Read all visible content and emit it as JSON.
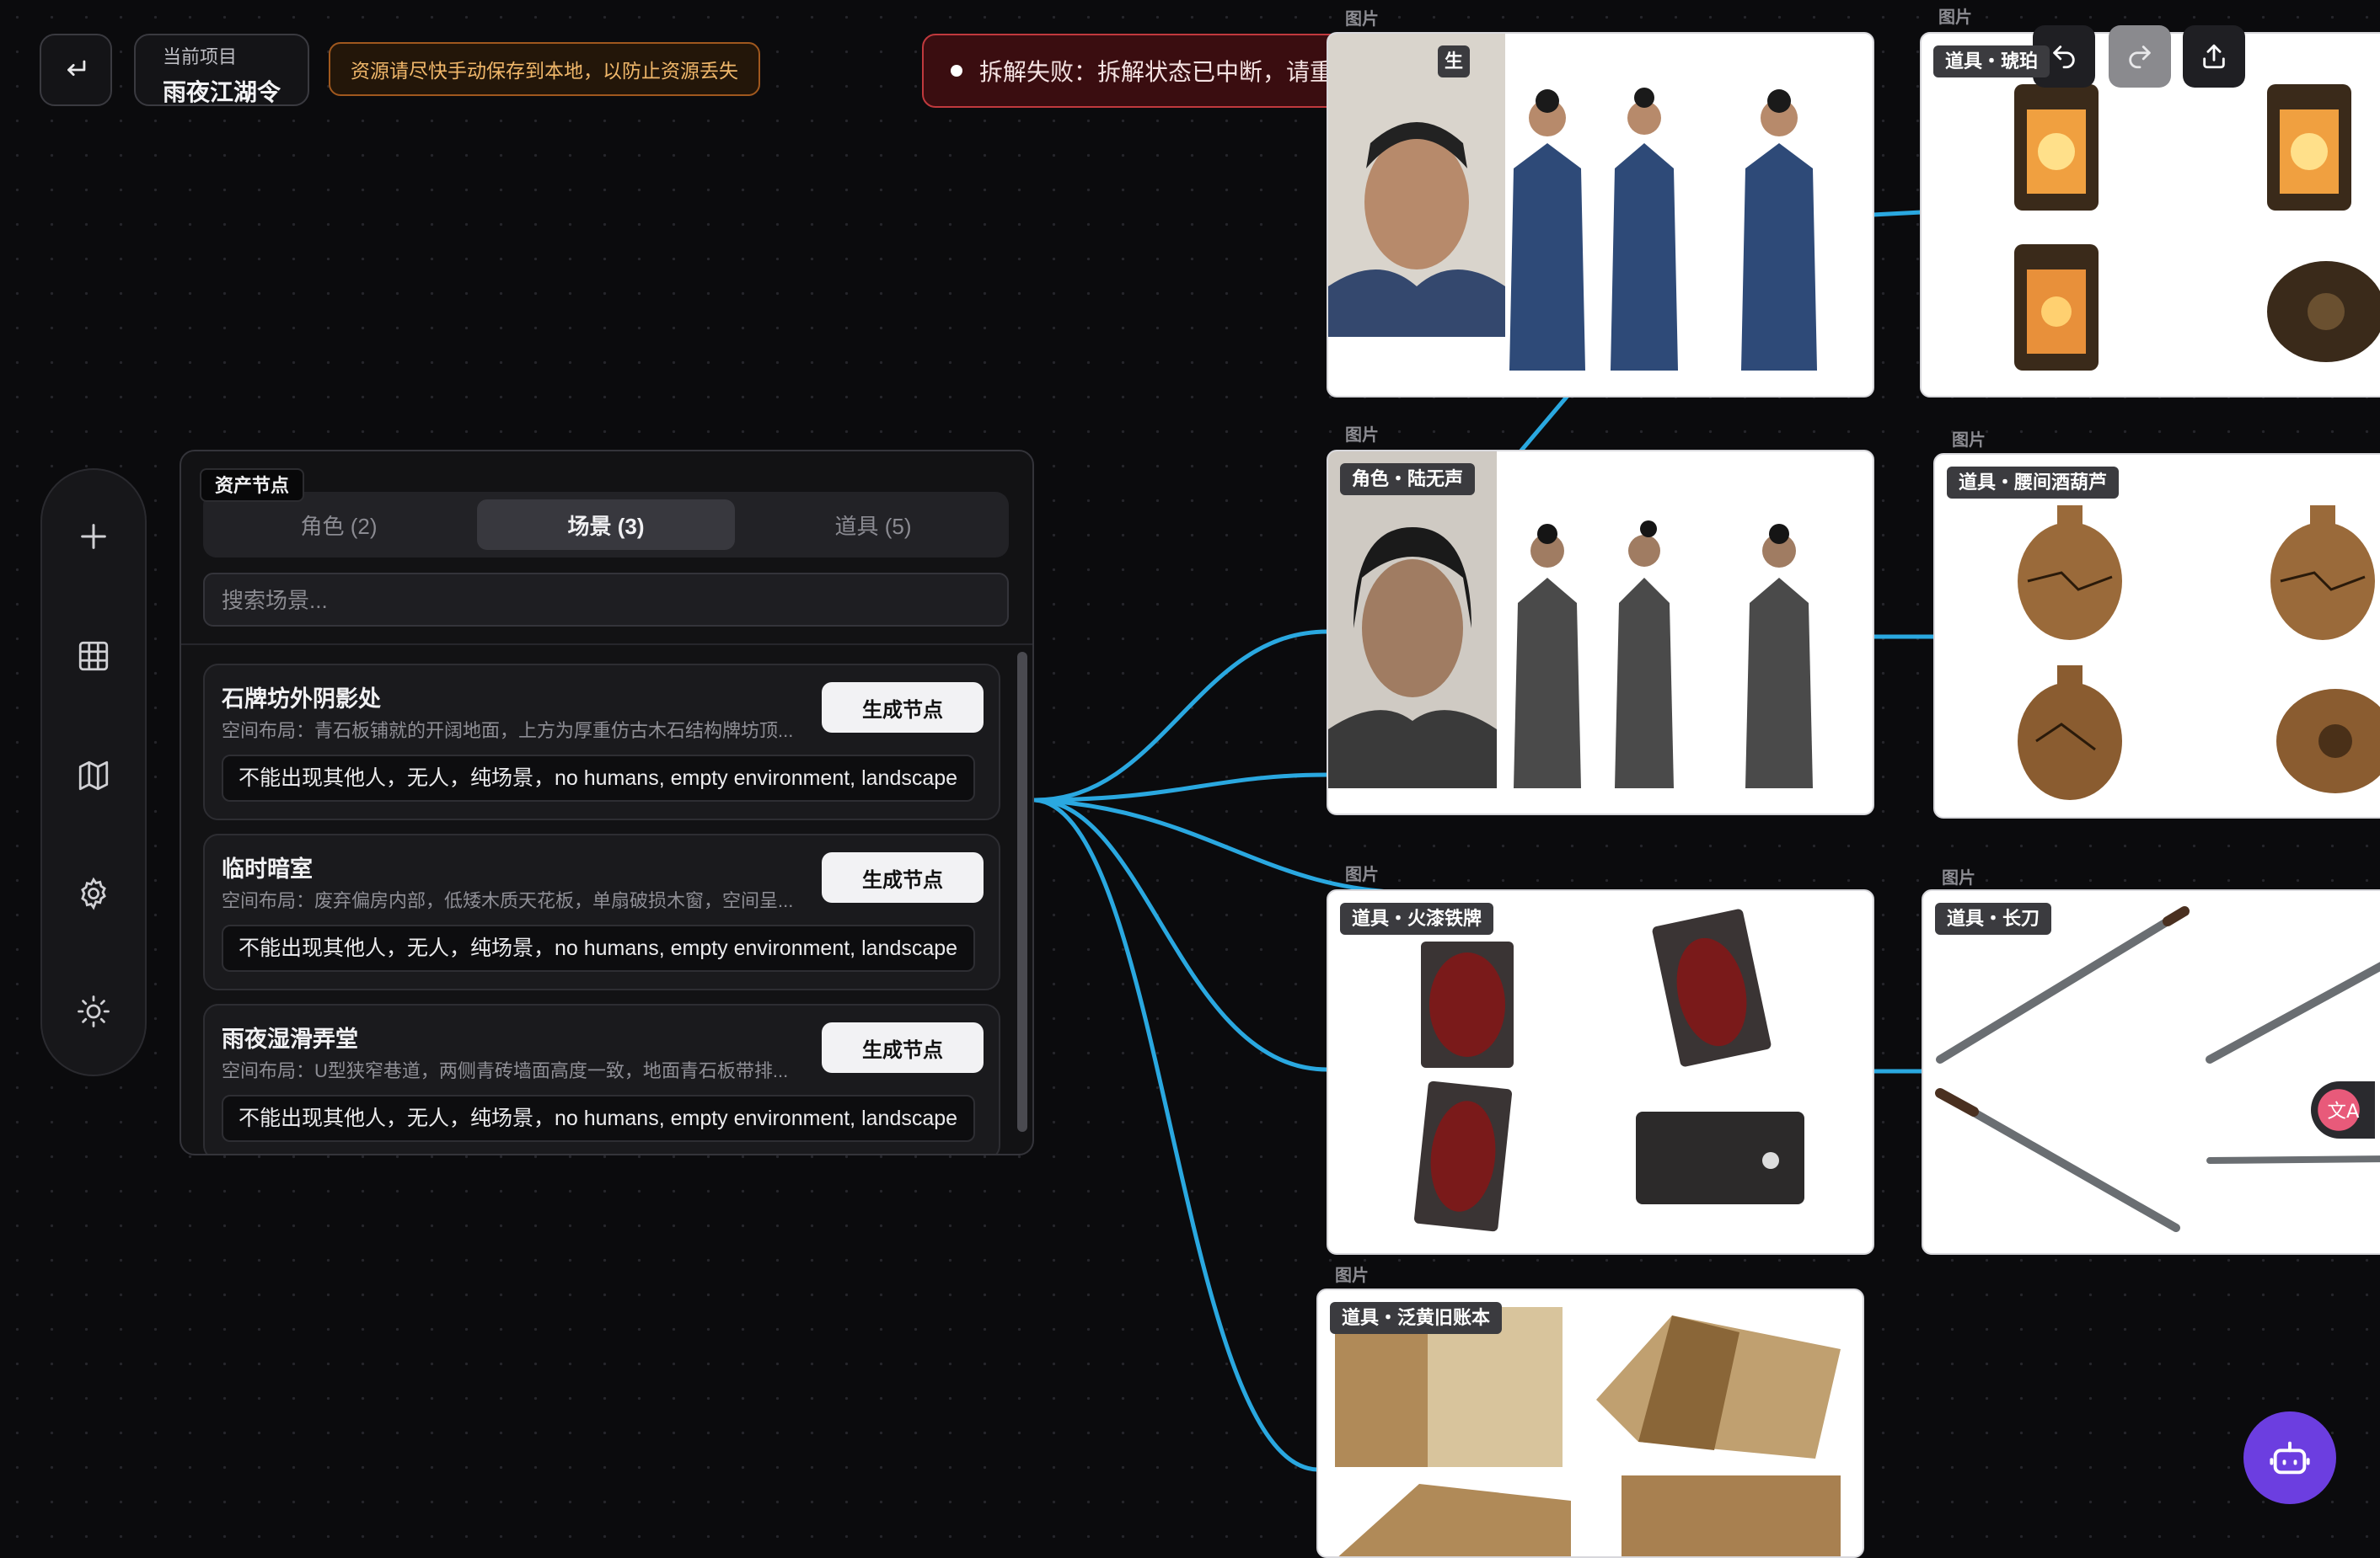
{
  "header": {
    "project_label": "当前项目",
    "project_name": "雨夜江湖令",
    "save_warning": "资源请尽快手动保存到本地，以防止资源丢失"
  },
  "toast": {
    "error_text": "拆解失败：拆解状态已中断，请重新拆解。"
  },
  "panel": {
    "title": "资产节点",
    "tabs": [
      {
        "label": "角色 (2)",
        "active": false
      },
      {
        "label": "场景 (3)",
        "active": true
      },
      {
        "label": "道具 (5)",
        "active": false
      }
    ],
    "search_placeholder": "搜索场景...",
    "generate_label": "生成节点",
    "scenes": [
      {
        "name": "石牌坊外阴影处",
        "desc": "空间布局：青石板铺就的开阔地面，上方为厚重仿古木石结构牌坊顶...",
        "negative": "不能出现其他人，无人，纯场景，no humans, empty environment, landscape"
      },
      {
        "name": "临时暗室",
        "desc": "空间布局：废弃偏房内部，低矮木质天花板，单扇破损木窗，空间呈...",
        "negative": "不能出现其他人，无人，纯场景，no humans, empty environment, landscape"
      },
      {
        "name": "雨夜湿滑弄堂",
        "desc": "空间布局：U型狭窄巷道，两侧青砖墙面高度一致，地面青石板带排...",
        "negative": "不能出现其他人，无人，纯场景，no humans, empty environment, landscape"
      }
    ]
  },
  "canvas": {
    "node_type_label": "图片",
    "badges": {
      "char1": "生",
      "char2": "角色・陆无声",
      "prop_lantern": "道具・琥珀",
      "prop_gourd": "道具・腰间酒葫芦",
      "prop_token": "道具・火漆铁牌",
      "prop_sword": "道具・长刀",
      "prop_book": "道具・泛黄旧账本"
    }
  },
  "colors": {
    "edge": "#2aa8e0",
    "error_bg": "#3a0d10",
    "warn_text": "#f0b76a",
    "bot": "#6c3ee0"
  },
  "icons": [
    "return-icon",
    "undo-icon",
    "redo-icon",
    "export-icon",
    "plus-icon",
    "grid-icon",
    "map-icon",
    "gear-icon",
    "sun-icon",
    "bot-icon",
    "translate-icon"
  ]
}
